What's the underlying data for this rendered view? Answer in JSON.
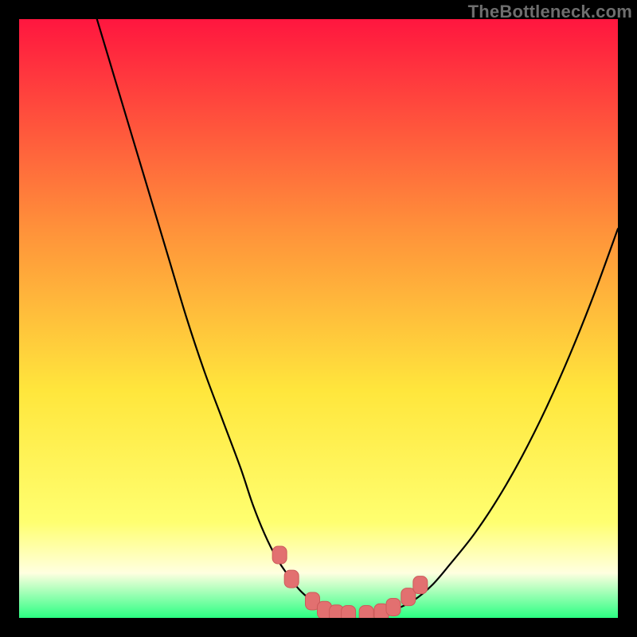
{
  "watermark": "TheBottleneck.com",
  "colors": {
    "gradient_top": "#ff163f",
    "gradient_upper_mid": "#ff913a",
    "gradient_mid": "#ffe63c",
    "gradient_lower_mid": "#ffff70",
    "gradient_white_band": "#ffffe0",
    "gradient_bottom": "#2bff82",
    "curve": "#000000",
    "marker_fill": "#e27070",
    "marker_stroke": "#cc5a5a"
  },
  "chart_data": {
    "type": "line",
    "title": "",
    "xlabel": "",
    "ylabel": "",
    "xlim": [
      0,
      100
    ],
    "ylim": [
      0,
      100
    ],
    "series": [
      {
        "name": "bottleneck-curve-left",
        "x": [
          13,
          16,
          19,
          22,
          25,
          28,
          31,
          34,
          37,
          39,
          41,
          43,
          45,
          47,
          49,
          50.5,
          52,
          53.5
        ],
        "values": [
          100,
          90,
          80,
          70,
          60,
          50,
          41,
          33,
          25,
          19,
          14,
          10,
          7,
          4.5,
          2.8,
          1.8,
          1.0,
          0.6
        ]
      },
      {
        "name": "bottleneck-curve-right",
        "x": [
          60,
          63,
          66,
          69,
          72,
          76,
          80,
          84,
          88,
          92,
          96,
          100
        ],
        "values": [
          0.6,
          1.5,
          3,
          5.5,
          9,
          14,
          20,
          27,
          35,
          44,
          54,
          65
        ]
      }
    ],
    "markers": [
      {
        "name": "marker-1",
        "x": 43.5,
        "y": 10.5
      },
      {
        "name": "marker-2",
        "x": 45.5,
        "y": 6.5
      },
      {
        "name": "marker-3",
        "x": 49.0,
        "y": 2.8
      },
      {
        "name": "marker-4",
        "x": 51.0,
        "y": 1.3
      },
      {
        "name": "marker-5",
        "x": 53.0,
        "y": 0.7
      },
      {
        "name": "marker-6",
        "x": 55.0,
        "y": 0.6
      },
      {
        "name": "marker-7",
        "x": 58.0,
        "y": 0.6
      },
      {
        "name": "marker-8",
        "x": 60.5,
        "y": 0.9
      },
      {
        "name": "marker-9",
        "x": 62.5,
        "y": 1.8
      },
      {
        "name": "marker-10",
        "x": 65.0,
        "y": 3.5
      },
      {
        "name": "marker-11",
        "x": 67.0,
        "y": 5.5
      }
    ]
  }
}
